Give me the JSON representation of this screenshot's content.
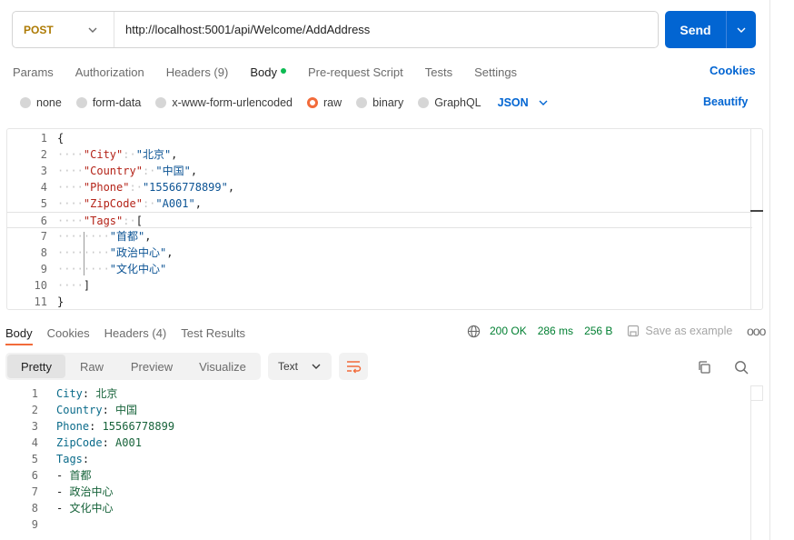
{
  "request": {
    "method": "POST",
    "url": "http://localhost:5001/api/Welcome/AddAddress",
    "send_label": "Send"
  },
  "request_tabs": [
    {
      "label": "Params"
    },
    {
      "label": "Authorization"
    },
    {
      "label": "Headers (9)"
    },
    {
      "label": "Body"
    },
    {
      "label": "Pre-request Script"
    },
    {
      "label": "Tests"
    },
    {
      "label": "Settings"
    }
  ],
  "cookies_label": "Cookies",
  "body_types": [
    {
      "label": "none"
    },
    {
      "label": "form-data"
    },
    {
      "label": "x-www-form-urlencoded"
    },
    {
      "label": "raw"
    },
    {
      "label": "binary"
    },
    {
      "label": "GraphQL"
    }
  ],
  "raw_format": "JSON",
  "beautify_label": "Beautify",
  "request_body_lines": [
    {
      "n": "1",
      "ind": "",
      "key": "",
      "sep": "",
      "val": "",
      "punc": "{"
    },
    {
      "n": "2",
      "ind": "····",
      "key": "\"City\"",
      "sep": ":·",
      "val": "\"北京\"",
      "punc": ","
    },
    {
      "n": "3",
      "ind": "····",
      "key": "\"Country\"",
      "sep": ":·",
      "val": "\"中国\"",
      "punc": ","
    },
    {
      "n": "4",
      "ind": "····",
      "key": "\"Phone\"",
      "sep": ":·",
      "val": "\"15566778899\"",
      "punc": ","
    },
    {
      "n": "5",
      "ind": "····",
      "key": "\"ZipCode\"",
      "sep": ":·",
      "val": "\"A001\"",
      "punc": ","
    },
    {
      "n": "6",
      "ind": "····",
      "key": "\"Tags\"",
      "sep": ":·",
      "val": "",
      "punc": "["
    },
    {
      "n": "7",
      "ind": "········",
      "key": "",
      "sep": "",
      "val": "\"首都\"",
      "punc": ","
    },
    {
      "n": "8",
      "ind": "········",
      "key": "",
      "sep": "",
      "val": "\"政治中心\"",
      "punc": ","
    },
    {
      "n": "9",
      "ind": "········",
      "key": "",
      "sep": "",
      "val": "\"文化中心\"",
      "punc": ""
    },
    {
      "n": "10",
      "ind": "····",
      "key": "",
      "sep": "",
      "val": "",
      "punc": "]"
    },
    {
      "n": "11",
      "ind": "",
      "key": "",
      "sep": "",
      "val": "",
      "punc": "}"
    }
  ],
  "response_tabs": [
    {
      "label": "Body"
    },
    {
      "label": "Cookies"
    },
    {
      "label": "Headers (4)"
    },
    {
      "label": "Test Results"
    }
  ],
  "response_status": {
    "status": "200 OK",
    "time": "286 ms",
    "size": "256 B",
    "save_label": "Save as example",
    "more_label": "ooo"
  },
  "view_modes": [
    {
      "label": "Pretty"
    },
    {
      "label": "Raw"
    },
    {
      "label": "Preview"
    },
    {
      "label": "Visualize"
    }
  ],
  "response_format": "Text",
  "response_lines": [
    {
      "n": "1",
      "key": "City",
      "sep": ": ",
      "val": "北京"
    },
    {
      "n": "2",
      "key": "Country",
      "sep": ": ",
      "val": "中国"
    },
    {
      "n": "3",
      "key": "Phone",
      "sep": ": ",
      "val": "15566778899"
    },
    {
      "n": "4",
      "key": "ZipCode",
      "sep": ": ",
      "val": "A001"
    },
    {
      "n": "5",
      "key": "Tags",
      "sep": ":",
      "val": ""
    },
    {
      "n": "6",
      "key": "",
      "sep": "- ",
      "val": "首都"
    },
    {
      "n": "7",
      "key": "",
      "sep": "- ",
      "val": "政治中心"
    },
    {
      "n": "8",
      "key": "",
      "sep": "- ",
      "val": "文化中心"
    },
    {
      "n": "9",
      "key": "",
      "sep": "",
      "val": ""
    }
  ],
  "colors": {
    "accent": "#0265d2",
    "method": "#ad7a03",
    "active_radio": "#f26b3a",
    "status_ok": "#007f31"
  }
}
